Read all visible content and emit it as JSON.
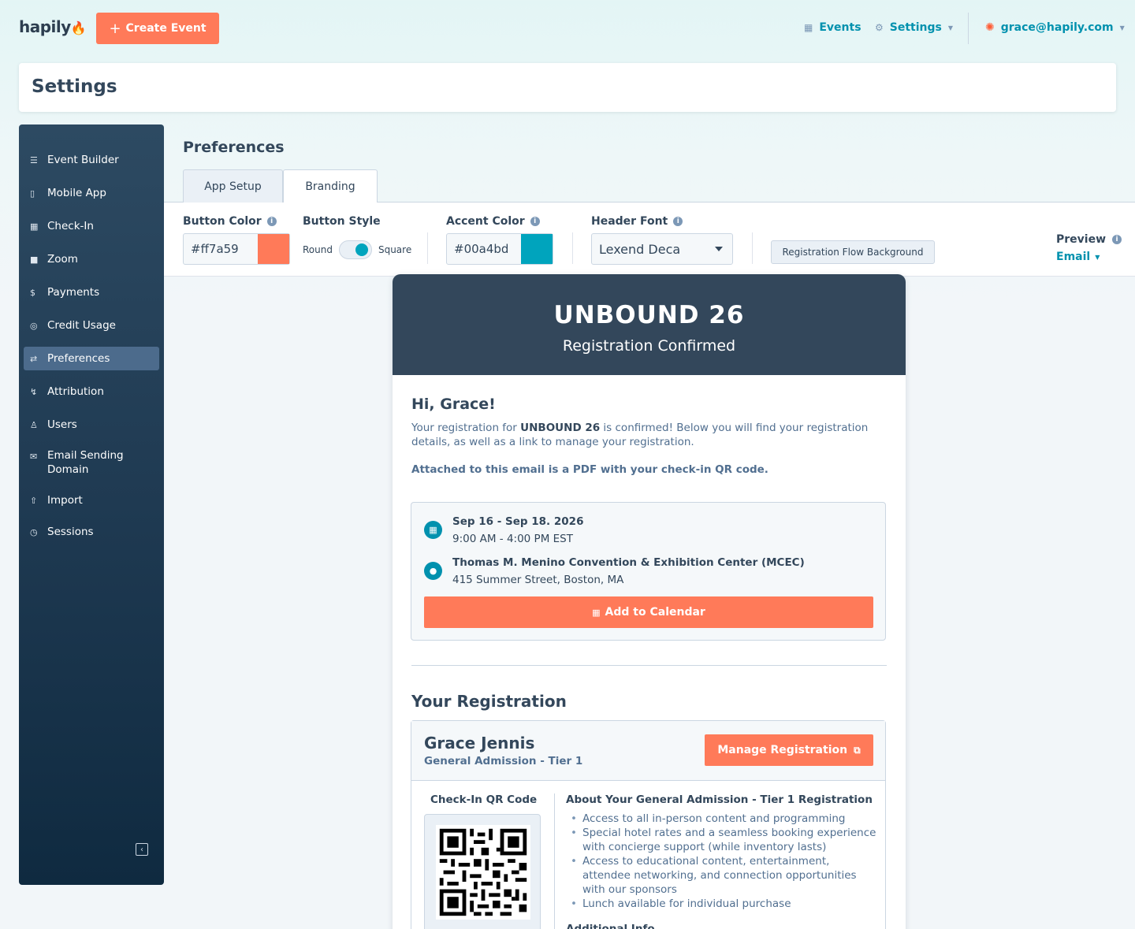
{
  "app": {
    "logo": "hapily",
    "create_button": "Create Event",
    "nav": {
      "events": "Events",
      "settings": "Settings",
      "user": "grace@hapily.com"
    }
  },
  "page": {
    "title": "Settings",
    "section_title": "Preferences"
  },
  "sidebar": {
    "items": [
      {
        "label": "Event Builder",
        "icon": "list-icon"
      },
      {
        "label": "Mobile App",
        "icon": "phone-icon"
      },
      {
        "label": "Check-In",
        "icon": "qr-icon"
      },
      {
        "label": "Zoom",
        "icon": "video-icon"
      },
      {
        "label": "Payments",
        "icon": "dollar-icon"
      },
      {
        "label": "Credit Usage",
        "icon": "credit-icon"
      },
      {
        "label": "Preferences",
        "icon": "preferences-icon",
        "active": true
      },
      {
        "label": "Attribution",
        "icon": "attribution-icon"
      },
      {
        "label": "Users",
        "icon": "users-icon"
      },
      {
        "label": "Email Sending Domain",
        "icon": "mail-icon"
      },
      {
        "label": "Import",
        "icon": "upload-icon"
      },
      {
        "label": "Sessions",
        "icon": "clock-icon"
      }
    ]
  },
  "tabs": [
    {
      "label": "App Setup"
    },
    {
      "label": "Branding",
      "active": true
    }
  ],
  "branding": {
    "button_color_label": "Button Color",
    "button_color_value": "#ff7a59",
    "button_style_label": "Button Style",
    "style_round": "Round",
    "style_square": "Square",
    "accent_color_label": "Accent Color",
    "accent_color_value": "#00a4bd",
    "header_font_label": "Header Font",
    "header_font_value": "Lexend Deca",
    "bg_button": "Registration Flow Background",
    "preview_label": "Preview",
    "preview_value": "Email"
  },
  "email": {
    "event_name": "UNBOUND 26",
    "header_sub": "Registration Confirmed",
    "greeting": "Hi, Grace!",
    "intro_pre": "Your registration for ",
    "intro_event": "UNBOUND 26",
    "intro_post": " is confirmed! Below you will find your registration details, as well as a link to manage your registration.",
    "attached": "Attached to this email is a PDF with your check-in QR code.",
    "dates": "Sep 16 - Sep 18. 2026",
    "times": "9:00 AM - 4:00 PM EST",
    "venue": "Thomas M. Menino Convention & Exhibition Center (MCEC)",
    "address": "415 Summer Street, Boston, MA",
    "calendar_button": "Add to Calendar",
    "your_registration": "Your Registration",
    "attendee_name": "Grace Jennis",
    "attendee_tier": "General Admission - Tier 1",
    "manage_button": "Manage Registration",
    "qr_label": "Check-In QR Code",
    "about_title": "About Your General Admission - Tier 1 Registration",
    "about_items": [
      "Access to all in-person content and programming",
      "Special hotel rates and a seamless booking experience with concierge support (while inventory lasts)",
      "Access to educational content, entertainment, attendee networking, and connection opportunities with our sponsors",
      "Lunch available for individual purchase"
    ],
    "additional_info": "Additional Info"
  },
  "colors": {
    "brand_orange": "#ff7a59",
    "accent_teal": "#00a4bd",
    "header_navy": "#33475b",
    "link": "#0091ae"
  }
}
